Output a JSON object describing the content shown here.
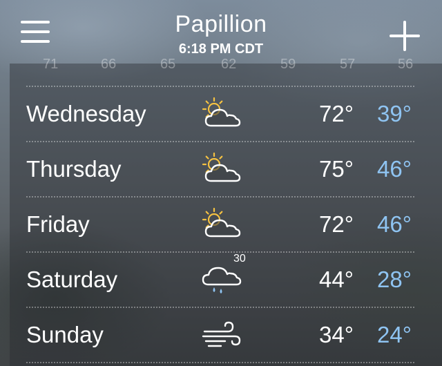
{
  "header": {
    "city": "Papillion",
    "time": "6:18 PM CDT"
  },
  "hourly_temps": [
    "71",
    "66",
    "65",
    "62",
    "59",
    "57",
    "56"
  ],
  "colors": {
    "low_temp": "#8fc4f2",
    "sun": "#f5c242",
    "text": "#ffffff"
  },
  "forecast": [
    {
      "day": "Wednesday",
      "icon": "partly-cloudy-icon",
      "precip": "",
      "high": "72°",
      "low": "39°"
    },
    {
      "day": "Thursday",
      "icon": "partly-cloudy-icon",
      "precip": "",
      "high": "75°",
      "low": "46°"
    },
    {
      "day": "Friday",
      "icon": "partly-cloudy-icon",
      "precip": "",
      "high": "72°",
      "low": "46°"
    },
    {
      "day": "Saturday",
      "icon": "rain-cloud-icon",
      "precip": "30",
      "high": "44°",
      "low": "28°"
    },
    {
      "day": "Sunday",
      "icon": "wind-icon",
      "precip": "",
      "high": "34°",
      "low": "24°"
    }
  ]
}
